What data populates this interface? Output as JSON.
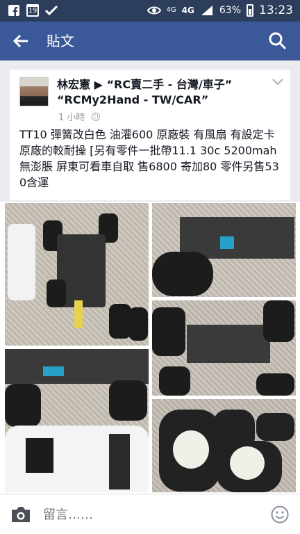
{
  "status_bar": {
    "calendar_day": "19",
    "network_1": "4G",
    "network_2": "4G",
    "battery": "63%",
    "time": "13:23",
    "icons": [
      "facebook-icon",
      "calendar-icon",
      "check-icon",
      "eye-icon",
      "signal-icon",
      "battery-icon"
    ]
  },
  "app_bar": {
    "title": "貼文",
    "back_icon": "back-arrow-icon",
    "search_icon": "search-icon"
  },
  "post": {
    "author": "林宏憲",
    "separator": "▶",
    "group": "“RC賣二手 - 台灣/車子” “RCMy2Hand - TW/CAR”",
    "time": "1 小時",
    "body": "TT10 彈簧改白色 油灌600 原廠裝 有風扇 有設定卡 原廠的較耐操 [另有零件一批帶11.1 30c 5200mah 無澎脹 屏東可看車自取 售6800 寄加80 零件另售530含運"
  },
  "comment": {
    "placeholder": "留言……"
  },
  "colors": {
    "status_bar": "#2d3e5c",
    "app_bar": "#3b5998",
    "text": "#141823"
  }
}
